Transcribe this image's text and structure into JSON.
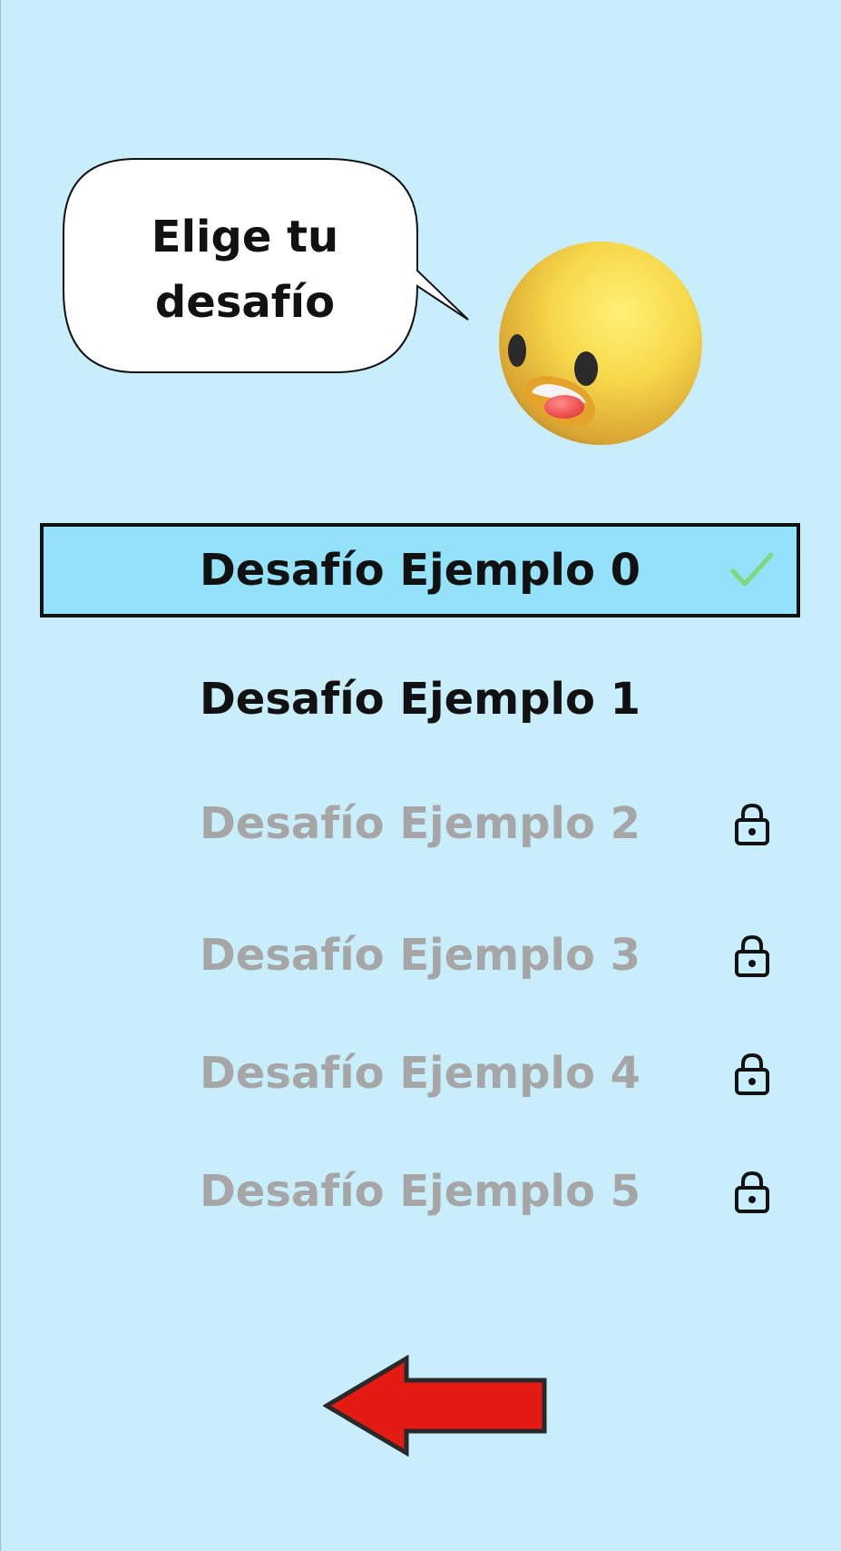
{
  "screen": {
    "background_color": "#c8eefb"
  },
  "speech_bubble": {
    "line1": "Elige tu",
    "line2": "desafío"
  },
  "character": {
    "icon": "surprised-emoji-face"
  },
  "challenges": [
    {
      "label": "Desafío Ejemplo 0",
      "state": "selected",
      "icon": "check-icon"
    },
    {
      "label": "Desafío Ejemplo 1",
      "state": "unlocked",
      "icon": ""
    },
    {
      "label": "Desafío Ejemplo 2",
      "state": "locked",
      "icon": "lock-icon"
    },
    {
      "label": "Desafío Ejemplo 3",
      "state": "locked",
      "icon": "lock-icon"
    },
    {
      "label": "Desafío Ejemplo 4",
      "state": "locked",
      "icon": "lock-icon"
    },
    {
      "label": "Desafío Ejemplo 5",
      "state": "locked",
      "icon": "lock-icon"
    }
  ],
  "colors": {
    "selected_background": "#94e2f9",
    "locked_text": "#a6a6a6",
    "check": "#7dd87a",
    "back_arrow": "#e51a13"
  },
  "back_button": {
    "icon": "left-arrow-icon"
  }
}
